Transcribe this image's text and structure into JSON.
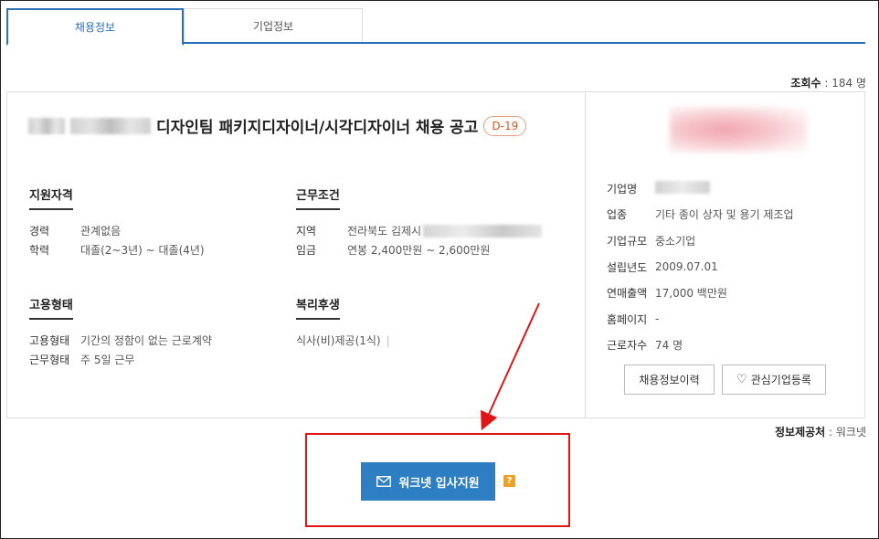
{
  "tabs": [
    {
      "label": "채용정보",
      "active": true
    },
    {
      "label": "기업정보",
      "active": false
    }
  ],
  "views": {
    "label": "조회수",
    "value": ": 184 명"
  },
  "job": {
    "title": "디자인팀 패키지디자이너/시각디자이너 채용 공고",
    "dday": "D-19"
  },
  "qualification": {
    "heading": "지원자격",
    "rows": [
      {
        "k": "경력",
        "v": "관계없음"
      },
      {
        "k": "학력",
        "v": "대졸(2~3년) ~ 대졸(4년)"
      }
    ]
  },
  "conditions": {
    "heading": "근무조건",
    "rows": [
      {
        "k": "지역",
        "v": "전라북도 김제시"
      },
      {
        "k": "임금",
        "v": "연봉 2,400만원 ~ 2,600만원"
      }
    ]
  },
  "employment": {
    "heading": "고용형태",
    "rows": [
      {
        "k": "고용형태",
        "v": "기간의 정함이 없는 근로계약"
      },
      {
        "k": "근무형태",
        "v": "주 5일 근무"
      }
    ]
  },
  "welfare": {
    "heading": "복리후생",
    "value": "식사(비)제공(1식)",
    "sep": "|"
  },
  "company": {
    "rows": [
      {
        "k": "기업명",
        "v": ""
      },
      {
        "k": "업종",
        "v": "기타 종이 상자 및 용기 제조업"
      },
      {
        "k": "기업규모",
        "v": "중소기업"
      },
      {
        "k": "설립년도",
        "v": "2009.07.01"
      },
      {
        "k": "연매출액",
        "v": "17,000 백만원"
      },
      {
        "k": "홈페이지",
        "v": "-"
      },
      {
        "k": "근로자수",
        "v": "74 명"
      }
    ],
    "btn_history": "채용정보이력",
    "btn_interest": "관심기업등록"
  },
  "provider": {
    "label": "정보제공처",
    "value": ": 워크넷"
  },
  "apply": {
    "label": "워크넷 입사지원",
    "help": "?"
  },
  "colors": {
    "accent": "#2a71b8",
    "apply": "#2d7ec3",
    "highlight": "#e01616",
    "dday": "#d9541e"
  }
}
